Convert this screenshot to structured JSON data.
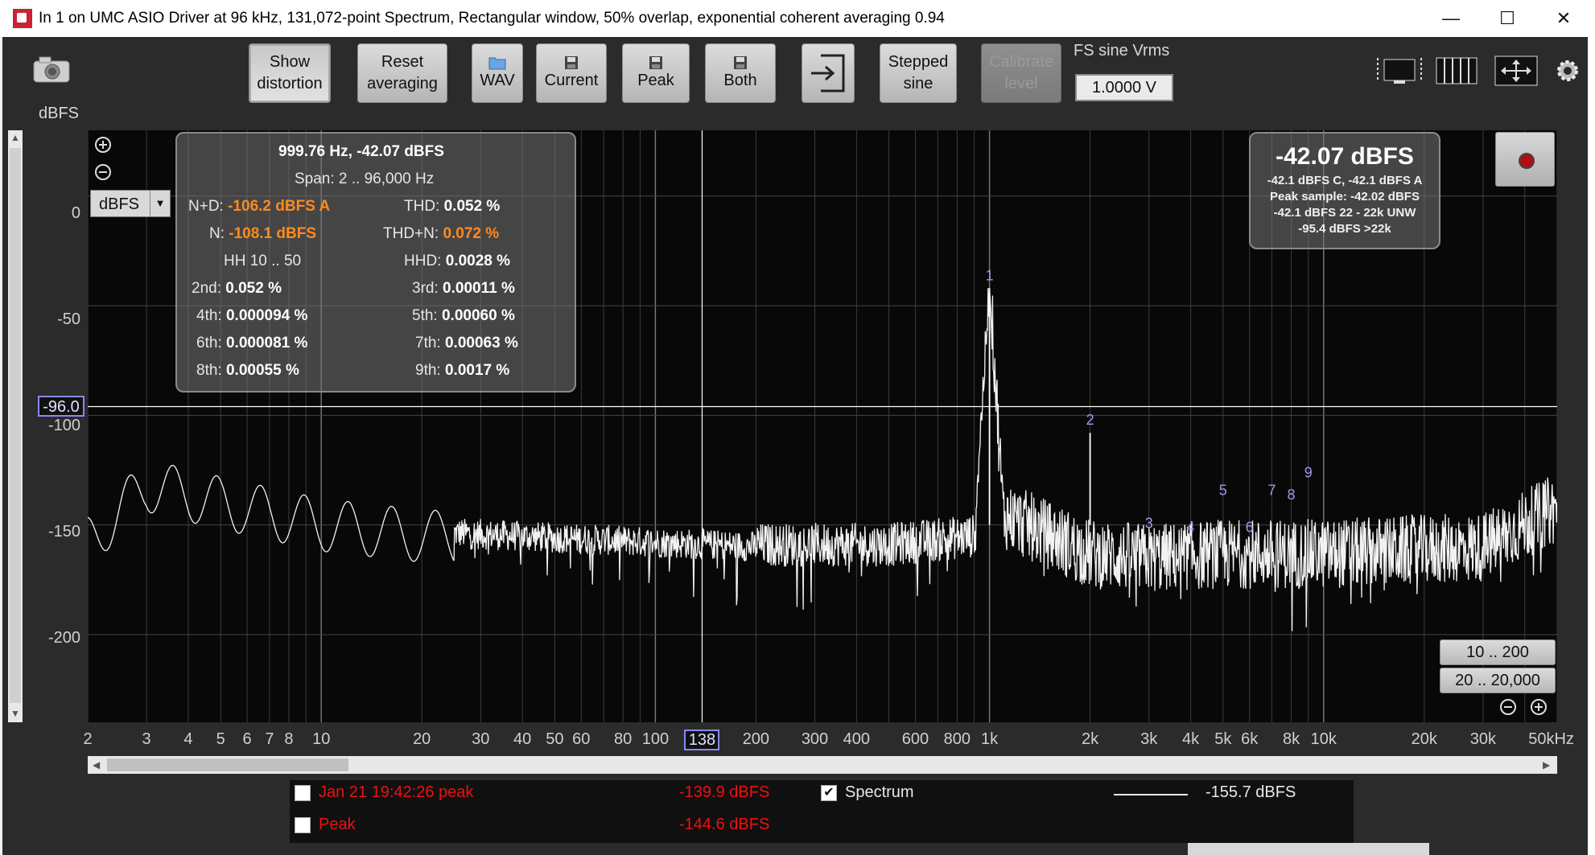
{
  "window": {
    "title": "In 1 on UMC ASIO Driver at 96 kHz, 131,072-point Spectrum, Rectangular window, 50% overlap, exponential coherent averaging 0.94",
    "minimize_glyph": "—",
    "maximize_glyph": "☐",
    "close_glyph": "✕"
  },
  "toolbar": {
    "show_distortion": [
      "Show",
      "distortion"
    ],
    "reset_averaging": [
      "Reset",
      "averaging"
    ],
    "wav": "WAV",
    "current": "Current",
    "peak": "Peak",
    "both": "Both",
    "stepped_sine": [
      "Stepped",
      "sine"
    ],
    "calibrate_level": [
      "Calibrate",
      "level"
    ],
    "fs_label": "FS sine Vrms",
    "fs_value": "1.0000 V"
  },
  "axes": {
    "y_unit": "dBFS",
    "y_ticks": [
      "0",
      "-50",
      "-100",
      "-150",
      "-200"
    ],
    "x_ticks": [
      "2",
      "3",
      "4",
      "5",
      "6",
      "7",
      "8",
      "10",
      "20",
      "30",
      "40",
      "50",
      "60",
      "80",
      "100",
      "200",
      "300",
      "400",
      "600",
      "800",
      "1k",
      "2k",
      "3k",
      "4k",
      "5k",
      "6k",
      "8k",
      "10k",
      "20k",
      "30k",
      "50kHz"
    ],
    "y_cursor": "-96.0",
    "x_cursor": "138",
    "unit_selector": "dBFS",
    "unit_dropdown_glyph": "▼"
  },
  "stats": {
    "freq_level": "999.76 Hz, -42.07 dBFS",
    "span": "Span: 2 .. 96,000 Hz",
    "nd_label": "N+D:",
    "nd_value": "-106.2 dBFS A",
    "thd_label": "THD:",
    "thd_value": "0.052 %",
    "n_label": "N:",
    "n_value": "-108.1 dBFS",
    "thdn_label": "THD+N:",
    "thdn_value": "0.072 %",
    "hh_label": "HH 10 .. 50",
    "hhd_label": "HHD:",
    "hhd_value": "0.0028 %",
    "h2_label": "2nd:",
    "h2_value": "0.052 %",
    "h3_label": "3rd:",
    "h3_value": "0.00011 %",
    "h4_label": "4th:",
    "h4_value": "0.000094 %",
    "h5_label": "5th:",
    "h5_value": "0.00060 %",
    "h6_label": "6th:",
    "h6_value": "0.000081 %",
    "h7_label": "7th:",
    "h7_value": "0.00063 %",
    "h8_label": "8th:",
    "h8_value": "0.00055 %",
    "h9_label": "9th:",
    "h9_value": "0.0017 %"
  },
  "level_panel": {
    "main": "-42.07 dBFS",
    "line1": "-42.1 dBFS C, -42.1 dBFS A",
    "line2": "Peak sample: -42.02 dBFS",
    "line3": "-42.1 dBFS 22 - 22k UNW",
    "line4": "-95.4 dBFS >22k"
  },
  "harmonic_markers": [
    "1",
    "2",
    "3",
    "4",
    "5",
    "6",
    "7",
    "8",
    "9"
  ],
  "range_buttons": [
    "10 .. 200",
    "20 .. 20,000"
  ],
  "legend": {
    "item1_label": "Jan 21 19:42:26 peak",
    "item1_value": "-139.9 dBFS",
    "item2_label": "Peak",
    "item2_value": "-144.6 dBFS",
    "spectrum_label": "Spectrum",
    "spectrum_value": "-155.7 dBFS",
    "spectrum_checked": "✔"
  },
  "chart_data": {
    "type": "line",
    "xscale": "log",
    "xlim": [
      2,
      50000
    ],
    "ylim": [
      -240,
      30
    ],
    "series": [
      {
        "name": "Spectrum",
        "x": [
          2,
          3,
          5,
          10,
          20,
          50,
          100,
          200,
          500,
          900,
          1000,
          1100,
          2000,
          3000,
          5000,
          10000,
          20000,
          30000,
          48000
        ],
        "y": [
          -158,
          -132,
          -140,
          -150,
          -155,
          -158,
          -160,
          -162,
          -162,
          -158,
          -42,
          -150,
          -168,
          -170,
          -168,
          -168,
          -166,
          -165,
          -148
        ]
      }
    ],
    "harmonics": [
      {
        "label": "1",
        "freq": 1000,
        "level": -42
      },
      {
        "label": "2",
        "freq": 2000,
        "level": -108
      },
      {
        "label": "3",
        "freq": 3000,
        "level": -155
      },
      {
        "label": "4",
        "freq": 4000,
        "level": -157
      },
      {
        "label": "5",
        "freq": 5000,
        "level": -140
      },
      {
        "label": "6",
        "freq": 6000,
        "level": -157
      },
      {
        "label": "7",
        "freq": 7000,
        "level": -140
      },
      {
        "label": "8",
        "freq": 8000,
        "level": -142
      },
      {
        "label": "9",
        "freq": 9000,
        "level": -132
      }
    ],
    "grid": true
  }
}
